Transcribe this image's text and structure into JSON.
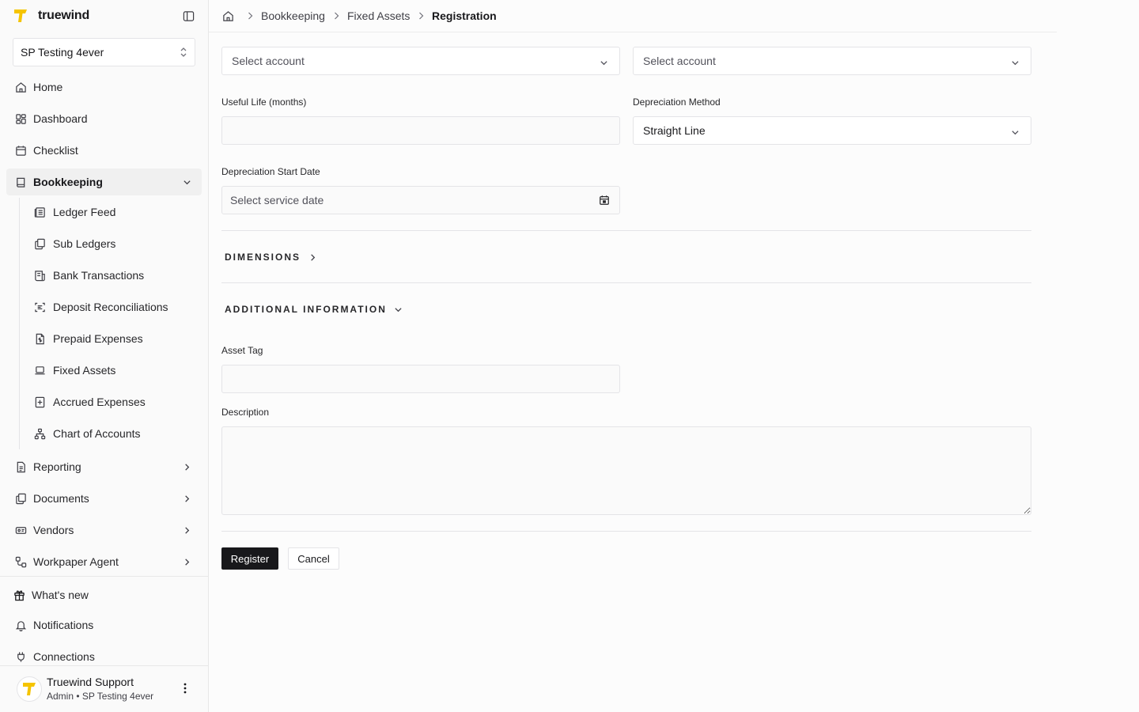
{
  "app": {
    "name": "truewind"
  },
  "org_select": {
    "value": "SP Testing 4ever"
  },
  "nav": {
    "home": "Home",
    "dashboard": "Dashboard",
    "checklist": "Checklist",
    "bookkeeping": "Bookkeeping",
    "reporting": "Reporting",
    "documents": "Documents",
    "vendors": "Vendors",
    "workpaper_agent": "Workpaper Agent"
  },
  "bookkeeping_sub": [
    {
      "label": "Ledger Feed",
      "icon": "ledger-feed-icon"
    },
    {
      "label": "Sub Ledgers",
      "icon": "sub-ledgers-icon"
    },
    {
      "label": "Bank Transactions",
      "icon": "bank-transactions-icon"
    },
    {
      "label": "Deposit Reconciliations",
      "icon": "deposit-reconciliations-icon"
    },
    {
      "label": "Prepaid Expenses",
      "icon": "prepaid-expenses-icon"
    },
    {
      "label": "Fixed Assets",
      "icon": "fixed-assets-icon"
    },
    {
      "label": "Accrued Expenses",
      "icon": "accrued-expenses-icon"
    },
    {
      "label": "Chart of Accounts",
      "icon": "chart-of-accounts-icon"
    }
  ],
  "footer_nav": {
    "whats_new": "What's new",
    "notifications": "Notifications",
    "connections": "Connections"
  },
  "user": {
    "name": "Truewind Support",
    "role": "Admin • SP Testing 4ever"
  },
  "breadcrumb": [
    "Bookkeeping",
    "Fixed Assets",
    "Registration"
  ],
  "form": {
    "account_select_1": {
      "placeholder": "Select account"
    },
    "account_select_2": {
      "placeholder": "Select account"
    },
    "useful_life": {
      "label": "Useful Life (months)",
      "value": ""
    },
    "depreciation_method": {
      "label": "Depreciation Method",
      "value": "Straight Line"
    },
    "depreciation_start_date": {
      "label": "Depreciation Start Date",
      "placeholder": "Select service date"
    },
    "dimensions": {
      "label": "DIMENSIONS"
    },
    "additional_information": {
      "label": "ADDITIONAL INFORMATION"
    },
    "asset_tag": {
      "label": "Asset Tag",
      "value": ""
    },
    "description": {
      "label": "Description",
      "value": ""
    },
    "register_label": "Register",
    "cancel_label": "Cancel"
  },
  "colors": {
    "brand_yellow": "#f5c400",
    "primary_button": "#18181b"
  }
}
